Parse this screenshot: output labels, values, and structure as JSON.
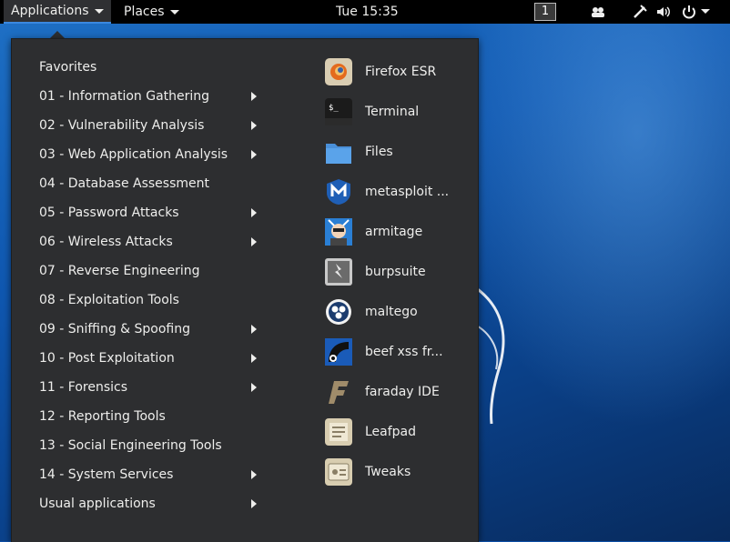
{
  "topbar": {
    "applications_label": "Applications",
    "places_label": "Places",
    "clock": "Tue 15:35",
    "workspace": "1",
    "tray": [
      "people-icon",
      "network-icon",
      "volume-icon",
      "power-icon"
    ]
  },
  "menu": {
    "categories": [
      {
        "label": "Favorites",
        "has_submenu": false
      },
      {
        "label": "01 - Information Gathering",
        "has_submenu": true
      },
      {
        "label": "02 - Vulnerability Analysis",
        "has_submenu": true
      },
      {
        "label": "03 - Web Application Analysis",
        "has_submenu": true
      },
      {
        "label": "04 - Database Assessment",
        "has_submenu": false
      },
      {
        "label": "05 - Password Attacks",
        "has_submenu": true
      },
      {
        "label": "06 - Wireless Attacks",
        "has_submenu": true
      },
      {
        "label": "07 - Reverse Engineering",
        "has_submenu": false
      },
      {
        "label": "08 - Exploitation Tools",
        "has_submenu": false
      },
      {
        "label": "09 - Sniffing & Spoofing",
        "has_submenu": true
      },
      {
        "label": "10 - Post Exploitation",
        "has_submenu": true
      },
      {
        "label": "11 - Forensics",
        "has_submenu": true
      },
      {
        "label": "12 - Reporting Tools",
        "has_submenu": false
      },
      {
        "label": "13 - Social Engineering Tools",
        "has_submenu": false
      },
      {
        "label": "14 - System Services",
        "has_submenu": true
      },
      {
        "label": "Usual applications",
        "has_submenu": true
      }
    ],
    "apps": [
      {
        "label": "Firefox ESR",
        "icon": "firefox-icon"
      },
      {
        "label": "Terminal",
        "icon": "terminal-icon"
      },
      {
        "label": "Files",
        "icon": "files-icon"
      },
      {
        "label": "metasploit ...",
        "icon": "metasploit-icon"
      },
      {
        "label": "armitage",
        "icon": "armitage-icon"
      },
      {
        "label": "burpsuite",
        "icon": "burpsuite-icon"
      },
      {
        "label": "maltego",
        "icon": "maltego-icon"
      },
      {
        "label": "beef xss fr...",
        "icon": "beef-icon"
      },
      {
        "label": "faraday IDE",
        "icon": "faraday-icon"
      },
      {
        "label": "Leafpad",
        "icon": "leafpad-icon"
      },
      {
        "label": "Tweaks",
        "icon": "tweaks-icon"
      }
    ]
  },
  "colors": {
    "topbar": "#000000",
    "menu_bg": "#2d2e30",
    "accent": "#3a88e0",
    "text": "#eeeeec"
  }
}
